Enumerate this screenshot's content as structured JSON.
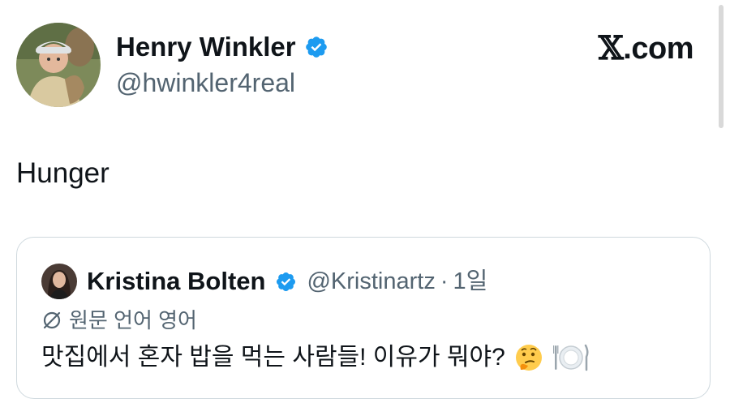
{
  "author": {
    "name": "Henry Winkler",
    "handle": "@hwinkler4real",
    "verified": true
  },
  "brand": {
    "label": ".com",
    "icon": "x-logo-icon"
  },
  "tweet": {
    "text": "Hunger"
  },
  "quoted_tweet": {
    "name": "Kristina Bolten",
    "verified": true,
    "handle": "@Kristinartz",
    "separator": "·",
    "time": "1일",
    "translate_label": "원문 언어 영어",
    "text": "맛집에서 혼자 밥을 먹는 사람들! 이유가 뭐야?",
    "emojis": [
      "thinking-face-icon",
      "plate-with-cutlery-icon"
    ]
  },
  "colors": {
    "text_primary": "#0f1419",
    "text_secondary": "#536471",
    "verified_blue": "#1d9bf0",
    "card_border": "#cfd9de"
  }
}
